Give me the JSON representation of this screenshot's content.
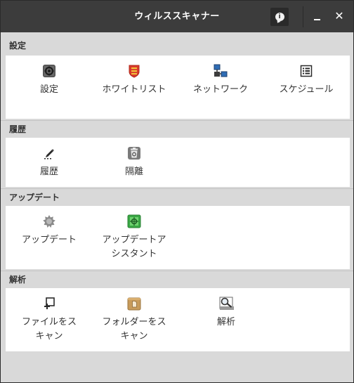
{
  "window": {
    "title": "ウィルススキャナー"
  },
  "titlebar": {
    "about_icon": "info-bubble-icon",
    "about_glyph": "i",
    "minimize_icon": "minimize-icon",
    "close_icon": "close-icon",
    "close_glyph": "✕"
  },
  "sections": [
    {
      "header": "設定",
      "items": [
        {
          "label": "設定",
          "icon": "settings-gear-icon"
        },
        {
          "label": "ホワイトリスト",
          "icon": "whitelist-shield-icon"
        },
        {
          "label": "ネットワーク",
          "icon": "network-icon"
        },
        {
          "label": "スケジュール",
          "icon": "schedule-list-icon"
        }
      ]
    },
    {
      "header": "履歴",
      "items": [
        {
          "label": "履歴",
          "icon": "history-pen-icon"
        },
        {
          "label": "隔離",
          "icon": "quarantine-trash-icon"
        }
      ]
    },
    {
      "header": "アップデート",
      "items": [
        {
          "label": "アップデート",
          "icon": "update-burst-icon"
        },
        {
          "label": "アップデートア\nシスタント",
          "icon": "update-assistant-icon"
        }
      ]
    },
    {
      "header": "解析",
      "items": [
        {
          "label": "ファイルをス\nキャン",
          "icon": "scan-file-icon"
        },
        {
          "label": "フォルダーをス\nキャン",
          "icon": "scan-folder-icon"
        },
        {
          "label": "解析",
          "icon": "analysis-magnifier-icon"
        }
      ]
    }
  ],
  "colors": {
    "titlebar": "#3c3c3c",
    "window_bg": "#d9d9d9",
    "panel_bg": "#ffffff",
    "text": "#333333"
  }
}
